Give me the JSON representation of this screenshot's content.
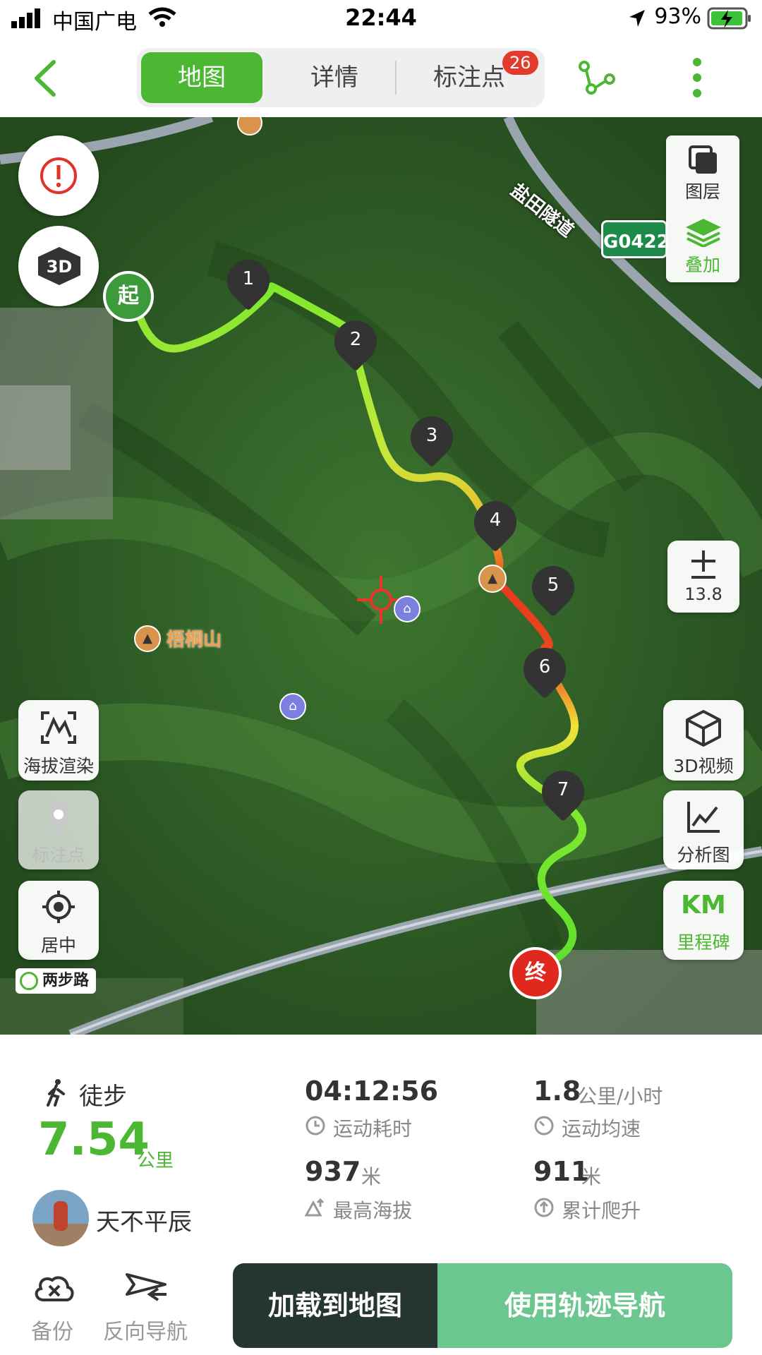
{
  "status_bar": {
    "carrier": "中国广电",
    "time": "22:44",
    "battery": "93%"
  },
  "nav": {
    "tabs": [
      {
        "label": "地图"
      },
      {
        "label": "详情"
      },
      {
        "label": "标注点"
      }
    ],
    "badge": "26"
  },
  "map": {
    "overlays": {
      "layers": "图层",
      "overlay": "叠加",
      "zoom": "13.8",
      "view3d": "3D视频",
      "analysis": "分析图",
      "km": "KM",
      "milestone": "里程碑",
      "elevation": "海拔渲染",
      "markers": "标注点",
      "center": "居中"
    },
    "labels": {
      "road": "盐田隧道",
      "highway": "G0422",
      "mountain": "梧桐山",
      "brand": "两步路",
      "start": "起",
      "end": "终"
    },
    "waypoints": [
      "1",
      "2",
      "3",
      "4",
      "5",
      "6",
      "7"
    ]
  },
  "stats": {
    "activity": "徒步",
    "distance": "7.54",
    "distance_unit": "公里",
    "duration": "04:12:56",
    "duration_label": "运动耗时",
    "speed": "1.8",
    "speed_unit": "公里/小时",
    "speed_label": "运动均速",
    "max_alt": "937",
    "max_alt_unit": "米",
    "max_alt_label": "最高海拔",
    "climb": "911",
    "climb_unit": "米",
    "climb_label": "累计爬升",
    "user": "天不平辰"
  },
  "actions": {
    "backup": "备份",
    "reverse": "反向导航",
    "load": "加载到地图",
    "navigate": "使用轨迹导航"
  },
  "colors": {
    "brand_green": "#4cb733",
    "nav_green": "#6cc68f",
    "dark_button": "#253530"
  }
}
